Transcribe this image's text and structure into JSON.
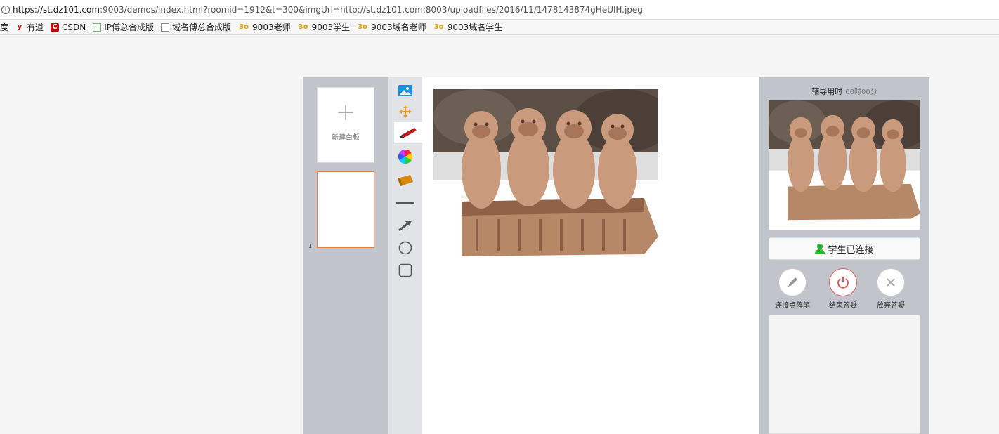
{
  "browser": {
    "url_scheme_host": "https://st.dz101.com",
    "url_rest": ":9003/demos/index.html?roomid=1912&t=300&imgUrl=http://st.dz101.com:8003/uploadfiles/2016/11/1478143874gHeUlH.jpeg",
    "bookmarks": [
      {
        "label": "度",
        "icon": "baidu-icon"
      },
      {
        "label": "有道",
        "icon": "youdao-icon"
      },
      {
        "label": "CSDN",
        "icon": "csdn-icon"
      },
      {
        "label": "IP傅总合成版",
        "icon": "ip-icon"
      },
      {
        "label": "域名傅总合成版",
        "icon": "document-icon"
      },
      {
        "label": "9003老师",
        "icon": "30-icon"
      },
      {
        "label": "9003学生",
        "icon": "30-icon"
      },
      {
        "label": "9003域名老师",
        "icon": "30-icon"
      },
      {
        "label": "9003域名学生",
        "icon": "30-icon"
      }
    ]
  },
  "pages": {
    "new_board_label": "新建白板",
    "thumb_number": "1"
  },
  "tools": [
    {
      "name": "image-tool",
      "icon": "image-icon"
    },
    {
      "name": "move-tool",
      "icon": "move-icon"
    },
    {
      "name": "pen-tool",
      "icon": "pen-icon",
      "active": true
    },
    {
      "name": "color-tool",
      "icon": "color-wheel-icon"
    },
    {
      "name": "eraser-tool",
      "icon": "eraser-icon"
    },
    {
      "name": "line-tool",
      "icon": "line-icon"
    },
    {
      "name": "arrow-tool",
      "icon": "arrow-icon"
    },
    {
      "name": "circle-tool",
      "icon": "circle-icon"
    },
    {
      "name": "rect-tool",
      "icon": "rectangle-icon"
    }
  ],
  "side": {
    "timer_label": "辅导用时",
    "timer_value": "00时00分",
    "status": "学生已连接",
    "actions": [
      {
        "label": "连接点阵笔",
        "icon": "pen-icon"
      },
      {
        "label": "结束答疑",
        "icon": "power-icon"
      },
      {
        "label": "放弃答疑",
        "icon": "close-icon"
      }
    ]
  },
  "colors": {
    "panel": "#c2c4cc",
    "active_thumb_border": "#d9824f",
    "end_button": "#e05a5a",
    "status_icon": "#2bb52b"
  }
}
